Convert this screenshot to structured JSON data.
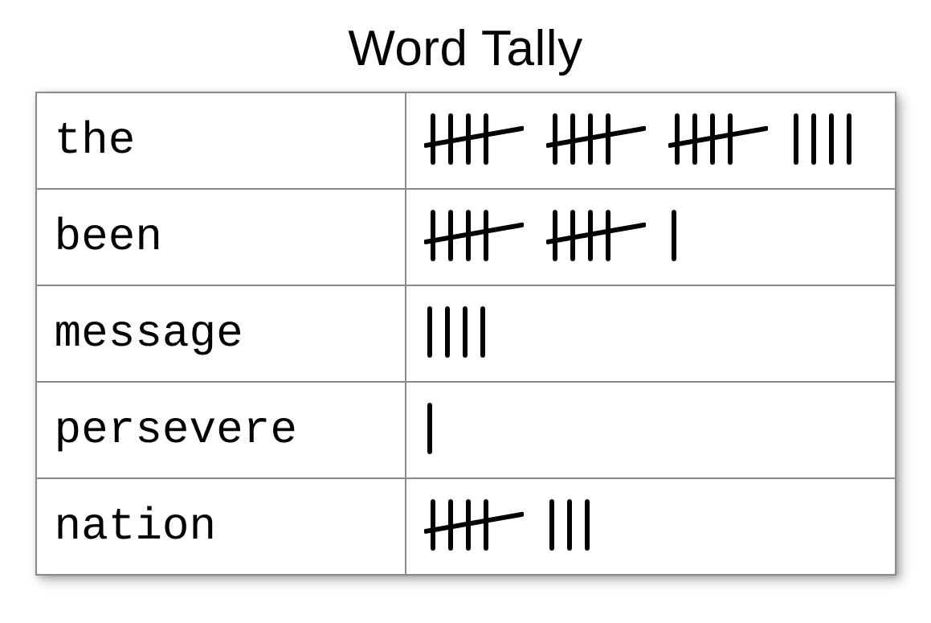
{
  "title": "Word Tally",
  "rows": [
    {
      "word": "the",
      "count": 19
    },
    {
      "word": "been",
      "count": 11
    },
    {
      "word": "message",
      "count": 4
    },
    {
      "word": "persevere",
      "count": 1
    },
    {
      "word": "nation",
      "count": 8
    }
  ],
  "chart_data": {
    "type": "table",
    "title": "Word Tally",
    "columns": [
      "word",
      "tally_count"
    ],
    "rows": [
      {
        "word": "the",
        "tally_count": 19
      },
      {
        "word": "been",
        "tally_count": 11
      },
      {
        "word": "message",
        "tally_count": 4
      },
      {
        "word": "persevere",
        "tally_count": 1
      },
      {
        "word": "nation",
        "tally_count": 8
      }
    ]
  }
}
